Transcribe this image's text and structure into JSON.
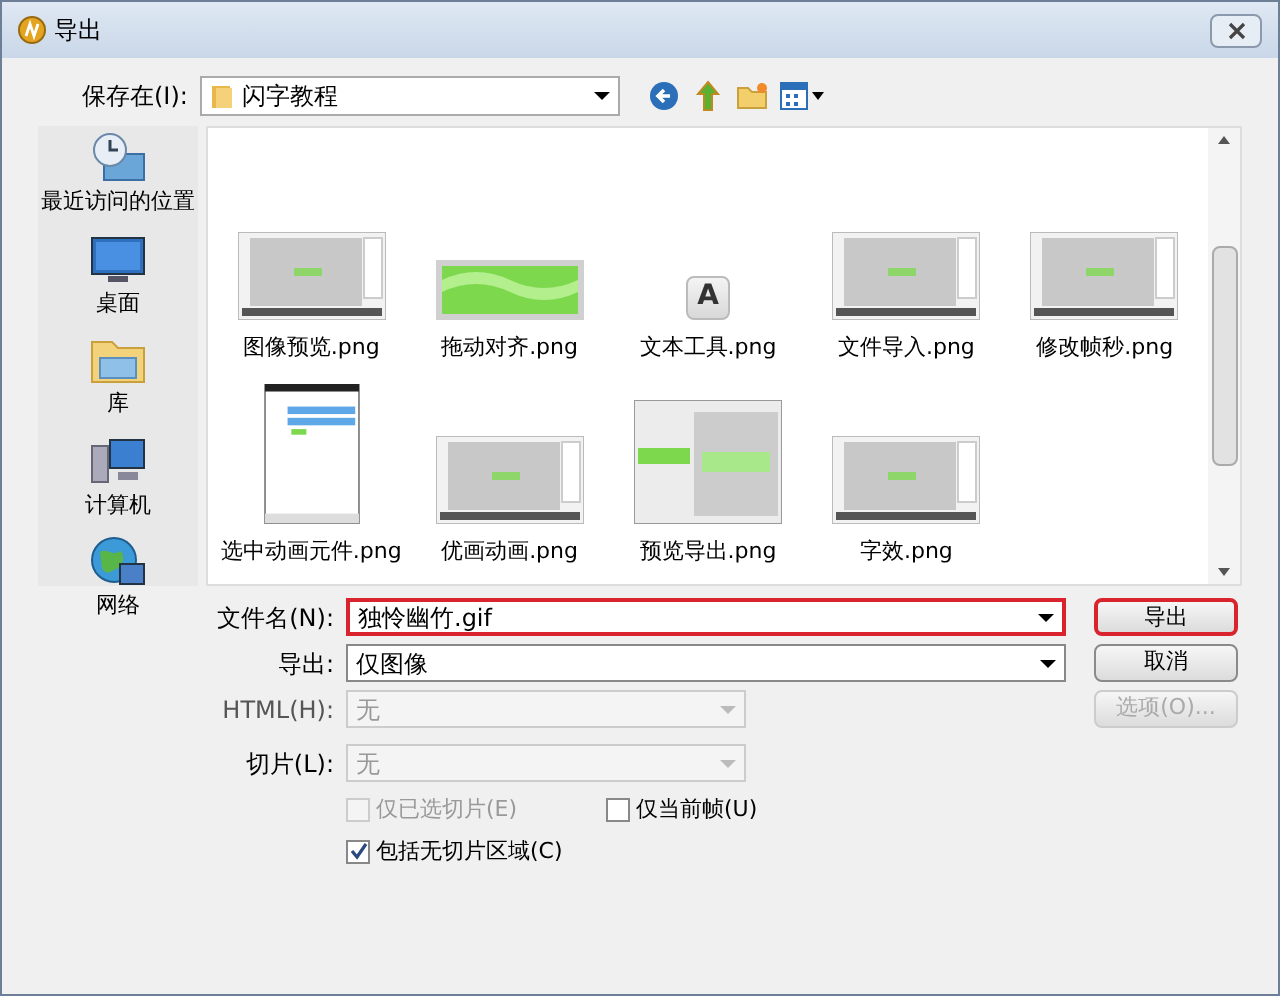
{
  "window": {
    "title": "导出"
  },
  "save_in": {
    "label": "保存在(I):",
    "value": "闪字教程"
  },
  "places": [
    {
      "label": "最近访问的位置",
      "kind": "recent"
    },
    {
      "label": "桌面",
      "kind": "desktop"
    },
    {
      "label": "库",
      "kind": "library"
    },
    {
      "label": "计算机",
      "kind": "computer"
    },
    {
      "label": "网络",
      "kind": "network"
    }
  ],
  "files": [
    {
      "name": "图像预览.png",
      "kind": "screen"
    },
    {
      "name": "拖动对齐.png",
      "kind": "banner"
    },
    {
      "name": "文本工具.png",
      "kind": "glyph",
      "glyph": "A"
    },
    {
      "name": "文件导入.png",
      "kind": "screen"
    },
    {
      "name": "修改帧秒.png",
      "kind": "screen"
    },
    {
      "name": "选中动画元件.png",
      "kind": "panel"
    },
    {
      "name": "优画动画.png",
      "kind": "screen"
    },
    {
      "name": "预览导出.png",
      "kind": "preview"
    },
    {
      "name": "字效.png",
      "kind": "screen"
    }
  ],
  "file_name": {
    "label": "文件名(N):",
    "value": "独怜幽竹.gif",
    "highlighted": true
  },
  "export": {
    "label": "导出:",
    "value": "仅图像"
  },
  "html": {
    "label": "HTML(H):",
    "value": "无",
    "disabled": true
  },
  "slices": {
    "label": "切片(L):",
    "value": "无",
    "disabled": true
  },
  "checkboxes": [
    {
      "label": "仅已选切片(E)",
      "checked": false,
      "disabled": true
    },
    {
      "label": "仅当前帧(U)",
      "checked": false,
      "disabled": false
    },
    {
      "label": "包括无切片区域(C)",
      "checked": true,
      "disabled": false
    }
  ],
  "buttons": [
    {
      "label": "导出",
      "highlighted": true,
      "disabled": false
    },
    {
      "label": "取消",
      "highlighted": false,
      "disabled": false
    },
    {
      "label": "选项(O)...",
      "highlighted": false,
      "disabled": true
    }
  ]
}
